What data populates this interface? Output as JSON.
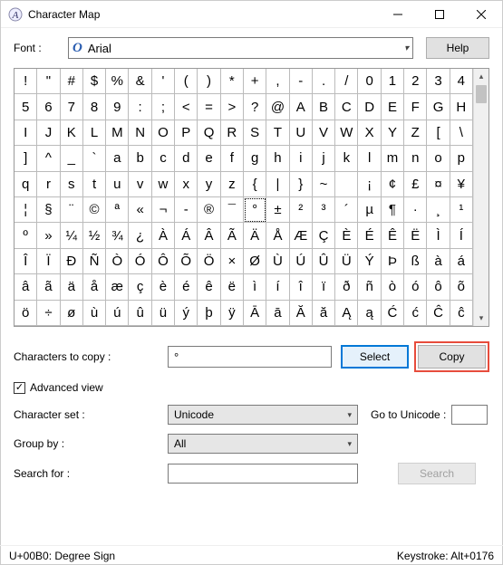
{
  "window": {
    "title": "Character Map"
  },
  "font_row": {
    "label": "Font :",
    "font_name": "Arial",
    "help_label": "Help"
  },
  "grid": {
    "chars": [
      "!",
      "\"",
      "#",
      "$",
      "%",
      "&",
      "'",
      "(",
      ")",
      "*",
      "+",
      ",",
      "-",
      ".",
      "/",
      "0",
      "1",
      "2",
      "3",
      "4",
      "5",
      "6",
      "7",
      "8",
      "9",
      ":",
      ";",
      "<",
      "=",
      ">",
      "?",
      "@",
      "A",
      "B",
      "C",
      "D",
      "E",
      "F",
      "G",
      "H",
      "I",
      "J",
      "K",
      "L",
      "M",
      "N",
      "O",
      "P",
      "Q",
      "R",
      "S",
      "T",
      "U",
      "V",
      "W",
      "X",
      "Y",
      "Z",
      "[",
      "\\",
      "]",
      "^",
      "_",
      "`",
      "a",
      "b",
      "c",
      "d",
      "e",
      "f",
      "g",
      "h",
      "i",
      "j",
      "k",
      "l",
      "m",
      "n",
      "o",
      "p",
      "q",
      "r",
      "s",
      "t",
      "u",
      "v",
      "w",
      "x",
      "y",
      "z",
      "{",
      "|",
      "}",
      "~",
      "",
      "¡",
      "¢",
      "£",
      "¤",
      "¥",
      "¦",
      "§",
      "¨",
      "©",
      "ª",
      "«",
      "¬",
      "-",
      "®",
      "¯",
      "°",
      "±",
      "²",
      "³",
      "´",
      "µ",
      "¶",
      "·",
      "¸",
      "¹",
      "º",
      "»",
      "¼",
      "½",
      "¾",
      "¿",
      "À",
      "Á",
      "Â",
      "Ã",
      "Ä",
      "Å",
      "Æ",
      "Ç",
      "È",
      "É",
      "Ê",
      "Ë",
      "Ì",
      "Í",
      "Î",
      "Ï",
      "Ð",
      "Ñ",
      "Ò",
      "Ó",
      "Ô",
      "Õ",
      "Ö",
      "×",
      "Ø",
      "Ù",
      "Ú",
      "Û",
      "Ü",
      "Ý",
      "Þ",
      "ß",
      "à",
      "á",
      "â",
      "ã",
      "ä",
      "å",
      "æ",
      "ç",
      "è",
      "é",
      "ê",
      "ë",
      "ì",
      "í",
      "î",
      "ï",
      "ð",
      "ñ",
      "ò",
      "ó",
      "ô",
      "õ",
      "ö",
      "÷",
      "ø",
      "ù",
      "ú",
      "û",
      "ü",
      "ý",
      "þ",
      "ÿ",
      "Ā",
      "ā",
      "Ă",
      "ă",
      "Ą",
      "ą",
      "Ć",
      "ć",
      "Ĉ",
      "ĉ"
    ],
    "selected_index": 110
  },
  "ctc": {
    "label": "Characters to copy :",
    "value": "°",
    "select_label": "Select",
    "copy_label": "Copy"
  },
  "advanced": {
    "checked": true,
    "label": "Advanced view"
  },
  "charset": {
    "label": "Character set :",
    "value": "Unicode",
    "goto_label": "Go to Unicode :",
    "goto_value": ""
  },
  "groupby": {
    "label": "Group by :",
    "value": "All"
  },
  "search": {
    "label": "Search for :",
    "value": "",
    "button_label": "Search"
  },
  "status": {
    "left": "U+00B0: Degree Sign",
    "right": "Keystroke: Alt+0176"
  }
}
